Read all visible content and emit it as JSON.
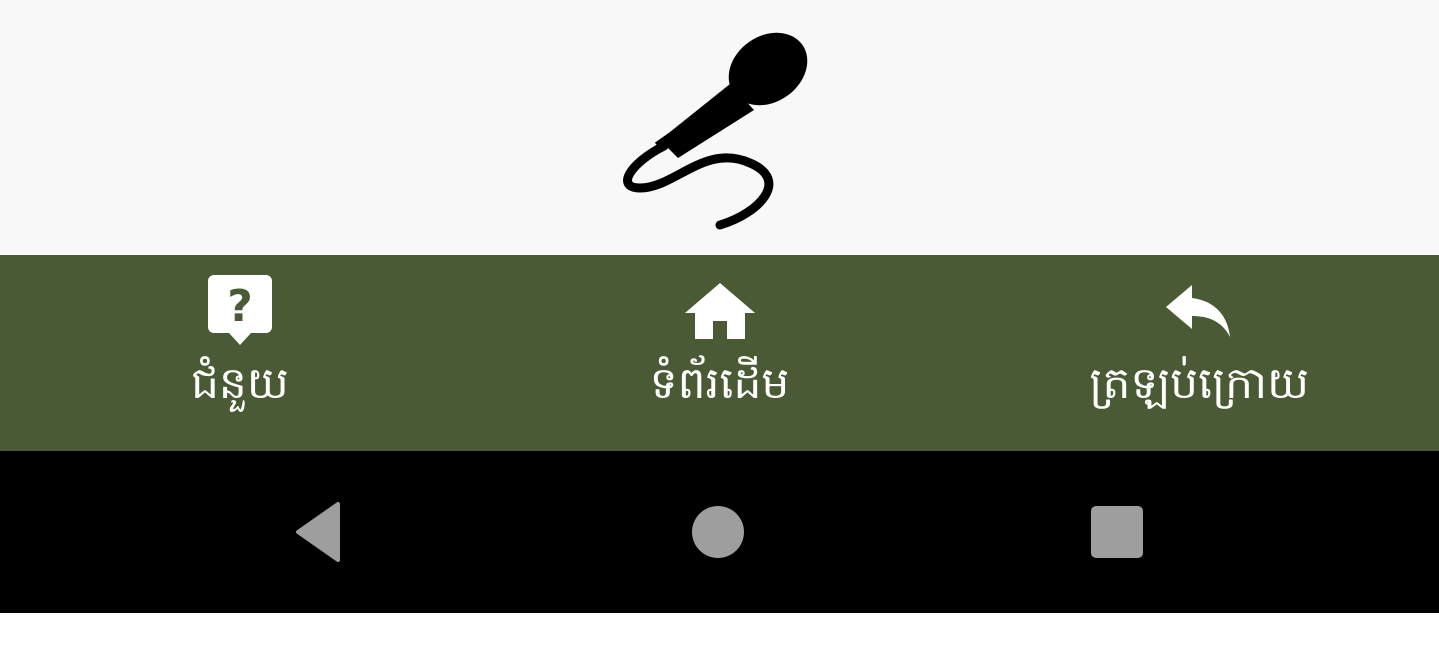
{
  "main": {
    "icon": "microphone-icon",
    "background": "#f8f8f8"
  },
  "bottom_nav": {
    "background": "#4a5a34",
    "items": [
      {
        "icon": "help-icon",
        "label": "ជំនួយ"
      },
      {
        "icon": "home-icon",
        "label": "ទំព័រដើម"
      },
      {
        "icon": "back-arrow-icon",
        "label": "ត្រឡប់ក្រោយ"
      }
    ]
  },
  "system_nav": {
    "background": "#000000",
    "buttons": [
      "back-triangle-icon",
      "home-circle-icon",
      "recents-square-icon"
    ],
    "button_color": "#9e9e9e"
  }
}
